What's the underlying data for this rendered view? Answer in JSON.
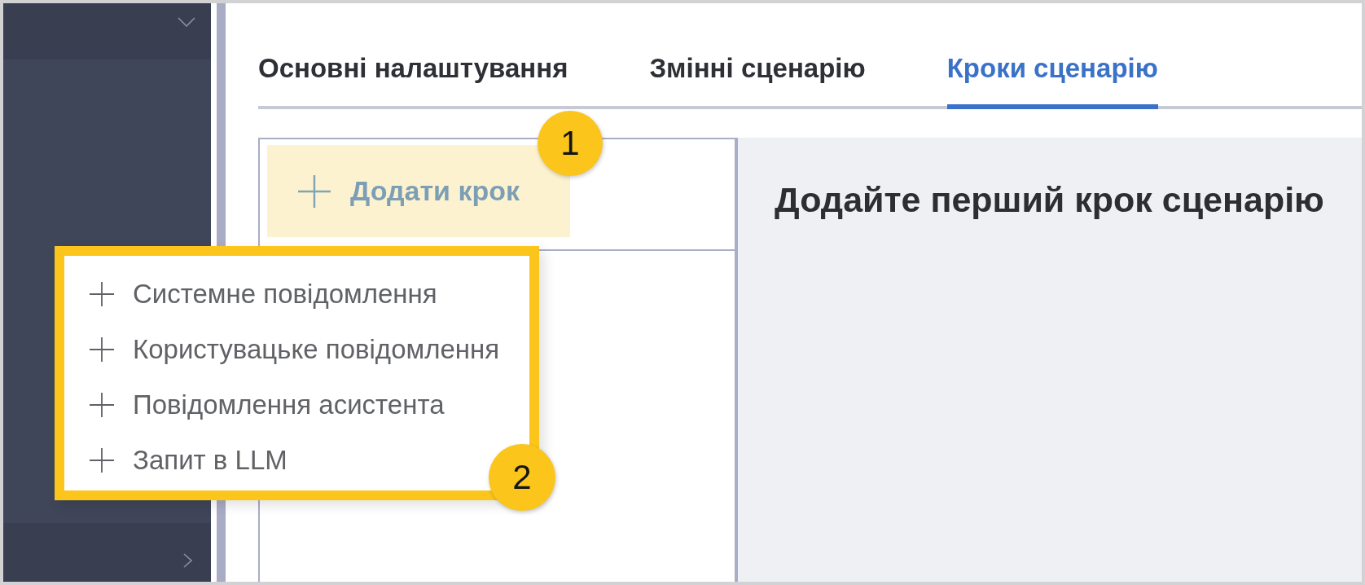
{
  "tabs": [
    {
      "label": "Основні налаштування",
      "selected": false
    },
    {
      "label": "Змінні сценарію",
      "selected": false
    },
    {
      "label": "Кроки сценарію",
      "selected": true
    }
  ],
  "steps_panel": {
    "add_button": {
      "label": "Додати крок",
      "highlighted": true,
      "callout": "1"
    }
  },
  "add_menu": {
    "highlighted": true,
    "callout": "2",
    "items": [
      {
        "label": "Системне повідомлення"
      },
      {
        "label": "Користувацьке повідомлення"
      },
      {
        "label": "Повідомлення асистента"
      },
      {
        "label": "Запит в LLM"
      }
    ]
  },
  "editor": {
    "empty_message": "Додайте перший крок сценарію"
  }
}
